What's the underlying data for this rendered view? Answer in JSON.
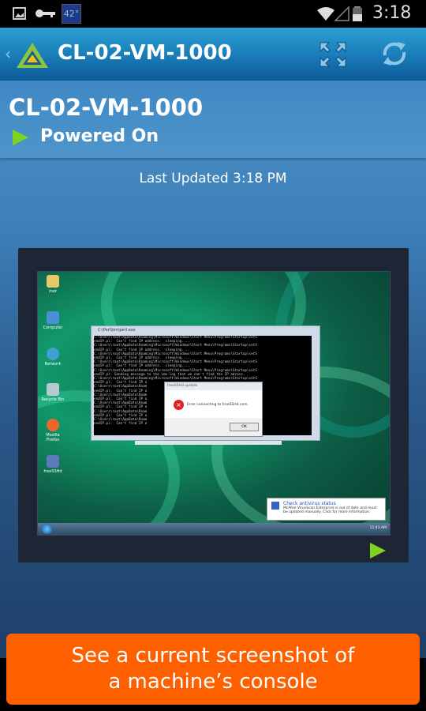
{
  "status_bar": {
    "temperature": "42°",
    "time": "3:18",
    "icons": [
      "image-icon",
      "key-icon",
      "wifi-icon",
      "cell-signal-icon",
      "battery-icon"
    ]
  },
  "app_bar": {
    "title": "CL-02-VM-1000",
    "icons": [
      "back-chevron-icon",
      "app-logo-icon",
      "fullscreen-icon",
      "refresh-icon"
    ]
  },
  "machine": {
    "name": "CL-02-VM-1000",
    "power_state": "Powered On",
    "last_updated": "Last Updated 3:18 PM"
  },
  "vm_screen": {
    "desktop_icons": [
      "root",
      "Computer",
      "Network",
      "Recycle Bin",
      "Mozilla Firefox",
      "freeSSHd"
    ],
    "console_title": "C:\\Perl\\bin\\perl.exe",
    "console_lines": [
      "C:\\Users\\root\\AppData\\Roaming\\Microsoft\\Windows\\Start Menu\\Programs\\Startup\\setS",
      "endIP.pl:  Can't find IP address.  sleeping....",
      "C:\\Users\\root\\AppData\\Roaming\\Microsoft\\Windows\\Start Menu\\Programs\\Startup\\setS",
      "endIP.pl:  Can't find IP address.  sleeping....",
      "C:\\Users\\root\\AppData\\Roaming\\Microsoft\\Windows\\Start Menu\\Programs\\Startup\\setS",
      "endIP.pl:  Can't find IP address.  sleeping....",
      "C:\\Users\\root\\AppData\\Roaming\\Microsoft\\Windows\\Start Menu\\Programs\\Startup\\setS",
      "endIP.pl:  Can't find IP address.  sleeping....",
      "C:\\Users\\root\\AppData\\Roaming\\Microsoft\\Windows\\Start Menu\\Programs\\Startup\\setS",
      "endIP.pl: Sending message to the vmx log that we can't find the IP adress.",
      "C:\\Users\\root\\AppData\\Roaming\\Microsoft\\Windows\\Start Menu\\Programs\\Startup\\setS",
      "endIP.pl:  Can't find IP a",
      "C:\\Users\\root\\AppData\\Roam",
      "endIP.pl:  Can't find IP a",
      "C:\\Users\\root\\AppData\\Roam",
      "endIP.pl:  Can't find IP a",
      "C:\\Users\\root\\AppData\\Roam",
      "endIP.pl:  Can't find IP a",
      "C:\\Users\\root\\AppData\\Roam",
      "endIP.pl:  Can't find IP a",
      "C:\\Users\\root\\AppData\\Roam",
      "endIP.pl:  Can't find IP a"
    ],
    "dialog_title": "freeSSHd update",
    "dialog_message": "Error connecting to freeSSHd.com.",
    "dialog_ok": "OK",
    "toast_title": "Check antivirus status",
    "toast_message": "McAfee VirusScan Enterprise is out of date and must be updated manually. Click for more information.",
    "clock": "11:43 AM"
  },
  "banner": {
    "line1": "See a current screenshot of",
    "line2": "a machine’s console"
  },
  "colors": {
    "accent": "#fe6000",
    "powered_on": "#7ed321",
    "app_bar": "#1a7ab6"
  }
}
